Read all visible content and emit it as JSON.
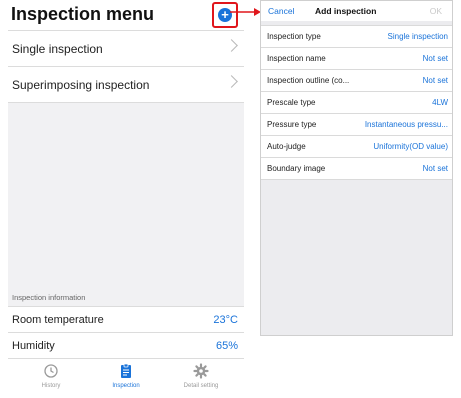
{
  "left": {
    "title": "Inspection menu",
    "add_icon": "+",
    "menu_items": [
      {
        "label": "Single inspection"
      },
      {
        "label": "Superimposing inspection"
      }
    ],
    "info_header": "Inspection information",
    "info_rows": [
      {
        "label": "Room temperature",
        "value": "23°C"
      },
      {
        "label": "Humidity",
        "value": "65%"
      }
    ],
    "tabs": [
      {
        "label": "History",
        "icon": "history-icon"
      },
      {
        "label": "Inspection",
        "icon": "clipboard-icon"
      },
      {
        "label": "Detail setting",
        "icon": "gear-icon"
      }
    ]
  },
  "right": {
    "cancel": "Cancel",
    "title": "Add inspection",
    "ok": "OK",
    "rows": [
      {
        "label": "Inspection type",
        "value": "Single inspection"
      },
      {
        "label": "Inspection name",
        "value": "Not set"
      },
      {
        "label": "Inspection outline (co...",
        "value": "Not set"
      },
      {
        "label": "Prescale type",
        "value": "4LW"
      },
      {
        "label": "Pressure type",
        "value": "Instantaneous pressu..."
      },
      {
        "label": "Auto-judge",
        "value": "Uniformity(OD value)"
      },
      {
        "label": "Boundary image",
        "value": "Not set"
      }
    ]
  },
  "colors": {
    "accent": "#1a73d9",
    "highlight": "#e0161b"
  }
}
